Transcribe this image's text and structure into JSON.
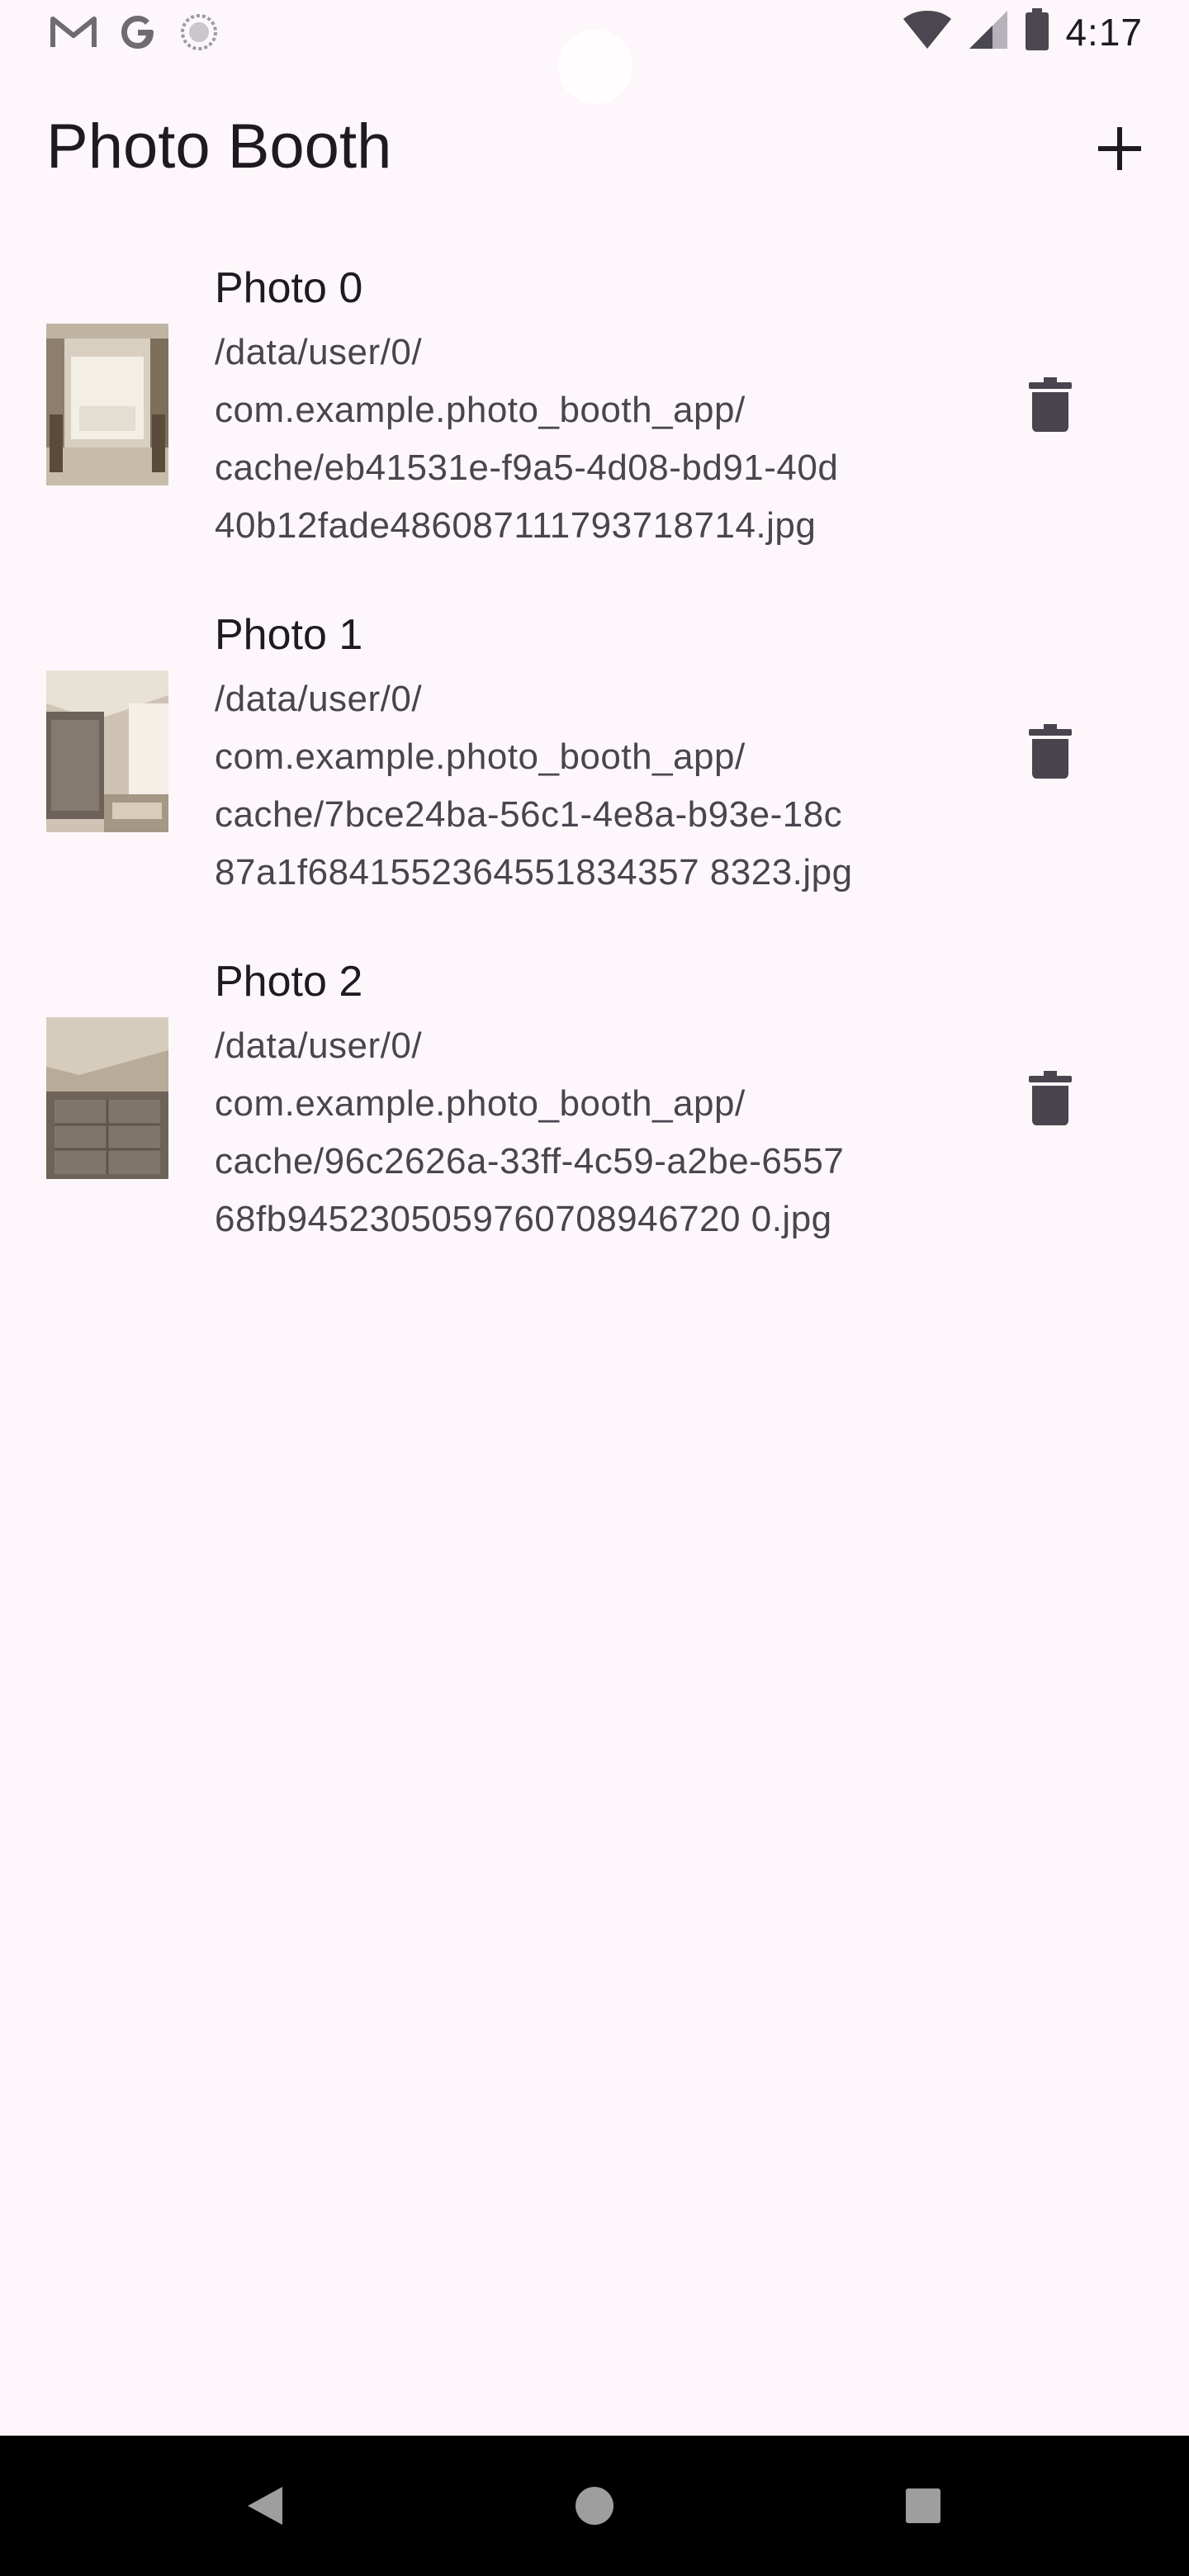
{
  "status_bar": {
    "time": "4:17",
    "left_icons": [
      "gmail-icon",
      "google-icon",
      "sync-circle-icon"
    ],
    "right_icons": [
      "wifi-icon",
      "cell-signal-icon",
      "battery-icon"
    ]
  },
  "app_bar": {
    "title": "Photo Booth",
    "add_icon": "plus-icon"
  },
  "photos": [
    {
      "title": "Photo 0",
      "lines": [
        "/data/user/0/",
        "com.example.photo_booth_app/",
        "cache/eb41531e-f9a5-4d08-bd91-40d",
        "40b12fade486087111793718714.jpg"
      ]
    },
    {
      "title": "Photo 1",
      "lines": [
        "/data/user/0/",
        "com.example.photo_booth_app/",
        "cache/7bce24ba-56c1-4e8a-b93e-18c",
        "87a1f6841552364551834357 8323.jpg"
      ]
    },
    {
      "title": "Photo 2",
      "lines": [
        "/data/user/0/",
        "com.example.photo_booth_app/",
        "cache/96c2626a-33ff-4c59-a2be-6557",
        "68fb9452305059760708946720 0.jpg"
      ]
    }
  ],
  "nav_bar": {
    "back_icon": "back-triangle-icon",
    "home_icon": "home-circle-icon",
    "recents_icon": "recents-square-icon"
  },
  "colors": {
    "background": "#FDF7FB",
    "text_primary": "#1D1B20",
    "text_secondary": "#49454F",
    "icon": "#49454F",
    "nav_bar": "#000000"
  }
}
